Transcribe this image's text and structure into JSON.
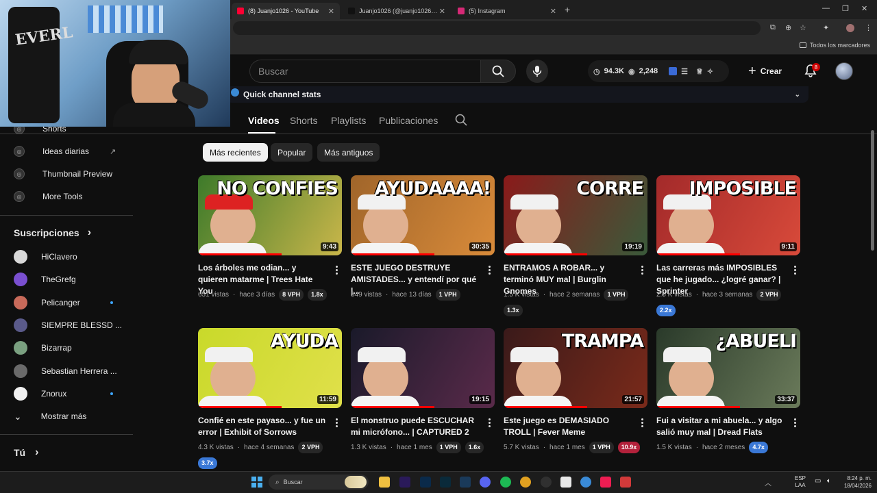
{
  "browser": {
    "tabs": [
      {
        "label": "(8) Juanjo1026 - YouTube",
        "active": true,
        "icon": "youtube-icon"
      },
      {
        "label": "Juanjo1026 (@juanjo1026_) | Ti",
        "active": false,
        "icon": "tiktok-icon"
      },
      {
        "label": "(5) Instagram",
        "active": false,
        "icon": "instagram-icon"
      }
    ],
    "new_tab": "+",
    "bookmarks_label": "Todos los marcadores"
  },
  "header": {
    "search_placeholder": "Buscar",
    "stats_views": "94.3K",
    "stats_watching": "2,248",
    "create_label": "Crear",
    "notif_count": "8"
  },
  "quick_stats": {
    "label": "Quick channel stats"
  },
  "channel_tabs": [
    {
      "label": "Videos",
      "active": true
    },
    {
      "label": "Shorts",
      "active": false
    },
    {
      "label": "Playlists",
      "active": false
    },
    {
      "label": "Publicaciones",
      "active": false
    }
  ],
  "sidebar": {
    "tools": [
      "Shorts",
      "Ideas diarias",
      "Thumbnail Preview",
      "More Tools"
    ],
    "subs_heading": "Suscripciones",
    "subs": [
      {
        "name": "HiClavero",
        "dot": false,
        "color": "#d8d8d8"
      },
      {
        "name": "TheGrefg",
        "dot": false,
        "color": "#7a4fd0"
      },
      {
        "name": "Pelicanger",
        "dot": true,
        "color": "#c86a5a"
      },
      {
        "name": "SIEMPRE BLESSD ...",
        "dot": false,
        "color": "#5a5a8a"
      },
      {
        "name": "Bizarrap",
        "dot": false,
        "color": "#7aa080"
      },
      {
        "name": "Sebastian Herrera ...",
        "dot": false,
        "color": "#6a6a6a"
      },
      {
        "name": "Znorux",
        "dot": true,
        "color": "#f1f1f1"
      }
    ],
    "show_more": "Mostrar más",
    "you_heading": "Tú"
  },
  "chips": [
    {
      "label": "Más recientes",
      "active": true
    },
    {
      "label": "Popular",
      "active": false
    },
    {
      "label": "Más antiguos",
      "active": false
    }
  ],
  "videos": [
    {
      "title": "Los árboles me odian... y quieren matarme | Trees Hate You",
      "views": "651 vistas",
      "age": "hace 3 días",
      "vph": "8 VPH",
      "mult": "1.8x",
      "mult_style": "gray",
      "duration": "9:43",
      "thumb_text": "NO CONFIES",
      "bg": "#3d7a2a",
      "bg2": "#c9b64a"
    },
    {
      "title": "ESTE JUEGO DESTRUYE AMISTADES... y entendí por qué |...",
      "views": "549 vistas",
      "age": "hace 13 días",
      "vph": "1 VPH",
      "mult": "",
      "mult_style": "gray",
      "duration": "30:35",
      "thumb_text": "AYUDAAAA!",
      "bg": "#a0652a",
      "bg2": "#d98b3a"
    },
    {
      "title": "ENTRAMOS A ROBAR... y terminó MUY mal | Burglin Gnomes",
      "views": "1.5 K vistas",
      "age": "hace 2 semanas",
      "vph": "1 VPH",
      "mult": "1.3x",
      "mult_style": "gray",
      "duration": "19:19",
      "thumb_text": "CORRE",
      "bg": "#8a1a1a",
      "bg2": "#3a5a3a"
    },
    {
      "title": "Las carreras más IMPOSIBLES que he jugado... ¿logré ganar? | Sprinter",
      "views": "2.5 K vistas",
      "age": "hace 3 semanas",
      "vph": "2 VPH",
      "mult": "2.2x",
      "mult_style": "blue",
      "duration": "9:11",
      "thumb_text": "IMPOSIBLE",
      "bg": "#a32a2a",
      "bg2": "#d84a3a"
    },
    {
      "title": "Confié en este payaso... y fue un error | Exhibit of Sorrows",
      "views": "4.3 K vistas",
      "age": "hace 4 semanas",
      "vph": "2 VPH",
      "mult": "3.7x",
      "mult_style": "blue",
      "duration": "11:59",
      "thumb_text": "AYUDA",
      "bg": "#c9d92a",
      "bg2": "#e0e04a"
    },
    {
      "title": "El monstruo puede ESCUCHAR mi micrófono... | CAPTURED 2",
      "views": "1.3 K vistas",
      "age": "hace 1 mes",
      "vph": "1 VPH",
      "mult": "1.6x",
      "mult_style": "gray",
      "duration": "19:15",
      "thumb_text": "",
      "bg": "#1a1a2a",
      "bg2": "#5a2a4a"
    },
    {
      "title": "Este juego es DEMASIADO TROLL | Fever Meme",
      "views": "5.7 K vistas",
      "age": "hace 1 mes",
      "vph": "1 VPH",
      "mult": "10.9x",
      "mult_style": "red",
      "duration": "21:57",
      "thumb_text": "TRAMPA",
      "bg": "#3a1a1a",
      "bg2": "#7a2a1a"
    },
    {
      "title": "Fui a visitar a mi abuela... y algo salió muy mal | Dread Flats",
      "views": "1.5 K vistas",
      "age": "hace 2 meses",
      "vph": "",
      "mult": "4.7x",
      "mult_style": "blue",
      "duration": "33:37",
      "thumb_text": "¿ABUELI",
      "bg": "#2a3a2a",
      "bg2": "#6a7a5a"
    }
  ],
  "taskbar": {
    "search_label": "Buscar",
    "lang_top": "ESP",
    "lang_bottom": "LAA",
    "time": "8:24 p. m.",
    "date": "18/04/2026"
  }
}
